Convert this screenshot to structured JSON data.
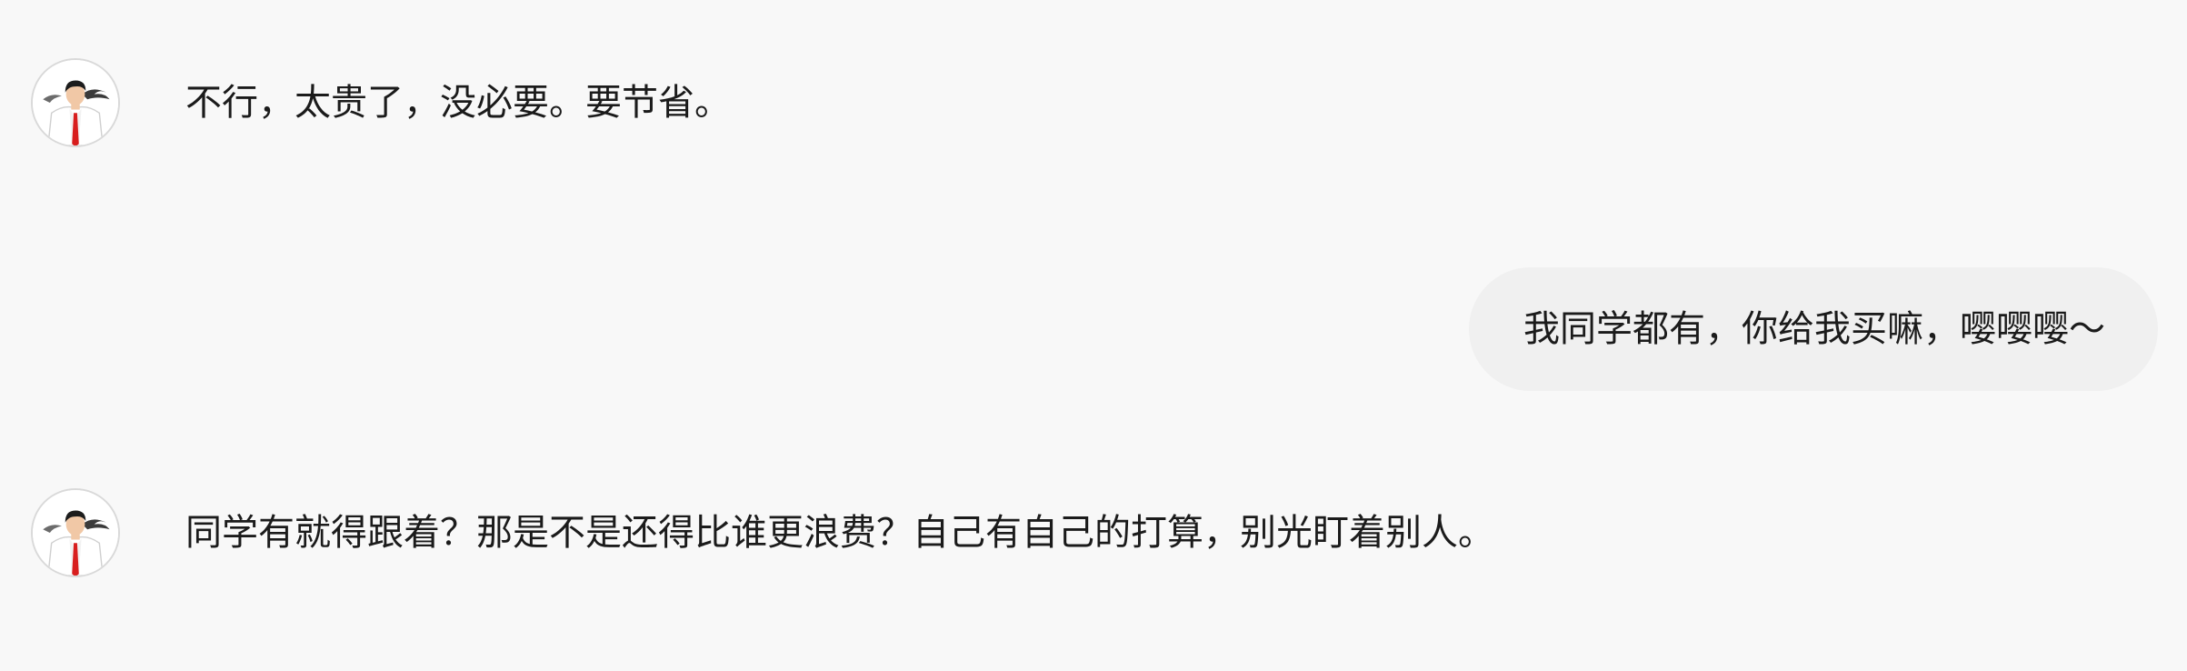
{
  "colors": {
    "background": "#f8f8f8",
    "user_bubble": "#f0f0f0",
    "text": "#1b1b1b"
  },
  "messages": [
    {
      "role": "assistant",
      "avatar_icon": "man-in-suit-avatar",
      "text": "不行，太贵了，没必要。要节省。"
    },
    {
      "role": "user",
      "text": "我同学都有，你给我买嘛，嘤嘤嘤～"
    },
    {
      "role": "assistant",
      "avatar_icon": "man-in-suit-avatar",
      "text": "同学有就得跟着？那是不是还得比谁更浪费？自己有自己的打算，别光盯着别人。"
    }
  ]
}
